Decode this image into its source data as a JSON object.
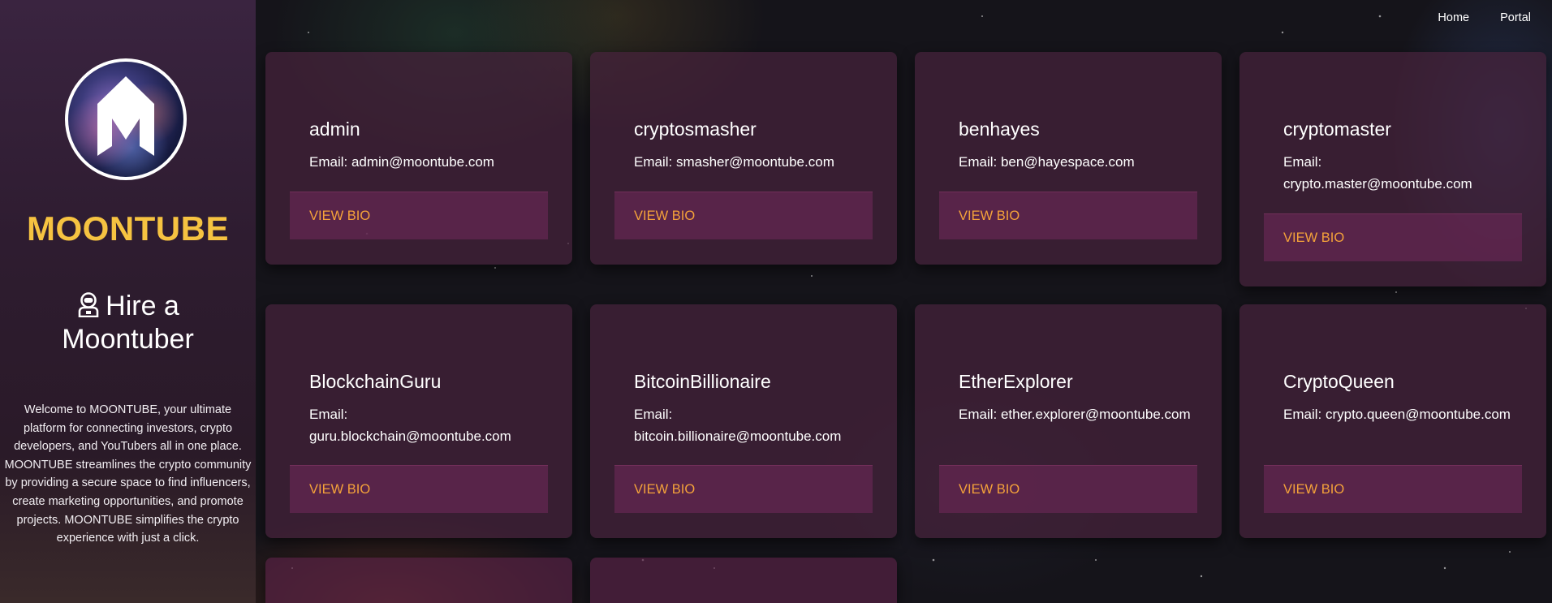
{
  "app": {
    "brand": "MOONTUBE",
    "heading": "Hire a Moontuber",
    "welcome": "Welcome to MOONTUBE, your ultimate platform for connecting investors, crypto developers, and YouTubers all in one place. MOONTUBE streamlines the crypto community by providing a secure space to find influencers, create marketing opportunities, and promote projects. MOONTUBE simplifies the crypto experience with just a click.",
    "logo_letter": "M"
  },
  "nav": {
    "home": "Home",
    "portal": "Portal"
  },
  "cards": [
    {
      "name": "admin",
      "email": "Email: admin@moontube.com",
      "button": "VIEW BIO"
    },
    {
      "name": "cryptosmasher",
      "email": "Email: smasher@moontube.com",
      "button": "VIEW BIO"
    },
    {
      "name": "benhayes",
      "email": "Email: ben@hayespace.com",
      "button": "VIEW BIO"
    },
    {
      "name": "cryptomaster",
      "email": "Email: crypto.master@moontube.com",
      "button": "VIEW BIO"
    },
    {
      "name": "BlockchainGuru",
      "email": "Email: guru.blockchain@moontube.com",
      "button": "VIEW BIO"
    },
    {
      "name": "BitcoinBillionaire",
      "email": "Email: bitcoin.billionaire@moontube.com",
      "button": "VIEW BIO"
    },
    {
      "name": "EtherExplorer",
      "email": "Email: ether.explorer@moontube.com",
      "button": "VIEW BIO"
    },
    {
      "name": "CryptoQueen",
      "email": "Email: crypto.queen@moontube.com",
      "button": "VIEW BIO"
    }
  ],
  "colors": {
    "brand": "#f6c341",
    "button_text": "#f4a23a",
    "card_bg": "#46223c",
    "sidebar_bg": "#2e1c30"
  },
  "icons": {
    "heading_icon": "astronaut-icon",
    "logo": "moontube-logo"
  }
}
